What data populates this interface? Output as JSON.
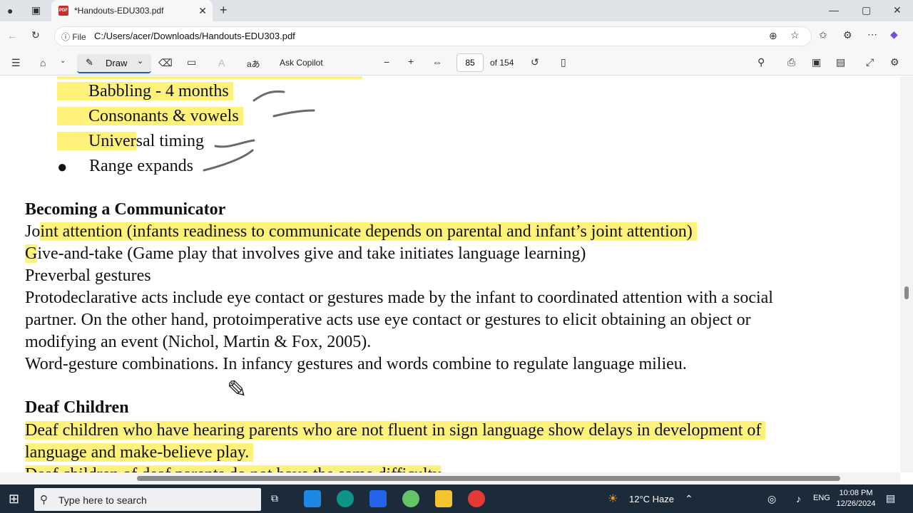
{
  "browser": {
    "tab_title": "*Handouts-EDU303.pdf",
    "tab_close": "✕",
    "file_chip": "File",
    "url": "C:/Users/acer/Downloads/Handouts-EDU303.pdf"
  },
  "toolbar": {
    "draw_label": "Draw",
    "ask_copilot": "Ask Copilot",
    "page_current": "85",
    "page_total": "of 154",
    "read_aloud": "aあ"
  },
  "document": {
    "bullets": [
      {
        "highlighted": "Babbling - 4 months",
        "rest": ""
      },
      {
        "highlighted": "Consonants & vowels",
        "rest": ""
      },
      {
        "highlighted": "Univer",
        "rest": "sal timing"
      },
      {
        "highlighted": "",
        "rest": "Range expands"
      }
    ],
    "heading1": "Becoming a Communicator",
    "p1_pre": "Jo",
    "p1_hl": "int attention (infants readiness to communicate depends on parental and infant’s joint attention)",
    "p2_hl": "G",
    "p2_rest": "ive-and-take (Game play that involves give and take initiates language learning)",
    "p3": "Preverbal gestures",
    "p4_l1": "Protodeclarative acts include eye contact or gestures made by the infant to coordinated attention with a social",
    "p4_l2": "partner. On the other hand, protoimperative acts use eye contact or gestures to elicit obtaining an object or",
    "p4_l3": "modifying an event (Nichol, Martin & Fox, 2005).",
    "p5": "Word-gesture combinations. In infancy gestures and words combine to regulate language milieu.",
    "heading2": "Deaf Children",
    "p6_l1": "Deaf children who have hearing parents who are not fluent in sign language show delays in development of",
    "p6_l2": "language and make-believe play.",
    "p7_partial": "Deaf children of deaf parents do not have the same difficulty"
  },
  "taskbar": {
    "search_placeholder": "Type here to search",
    "weather": "12°C  Haze",
    "language": "ENG",
    "time": "10:08 PM",
    "date": "12/26/2024"
  },
  "colors": {
    "highlight": "#fff27a",
    "accent": "#1a5ccf"
  }
}
